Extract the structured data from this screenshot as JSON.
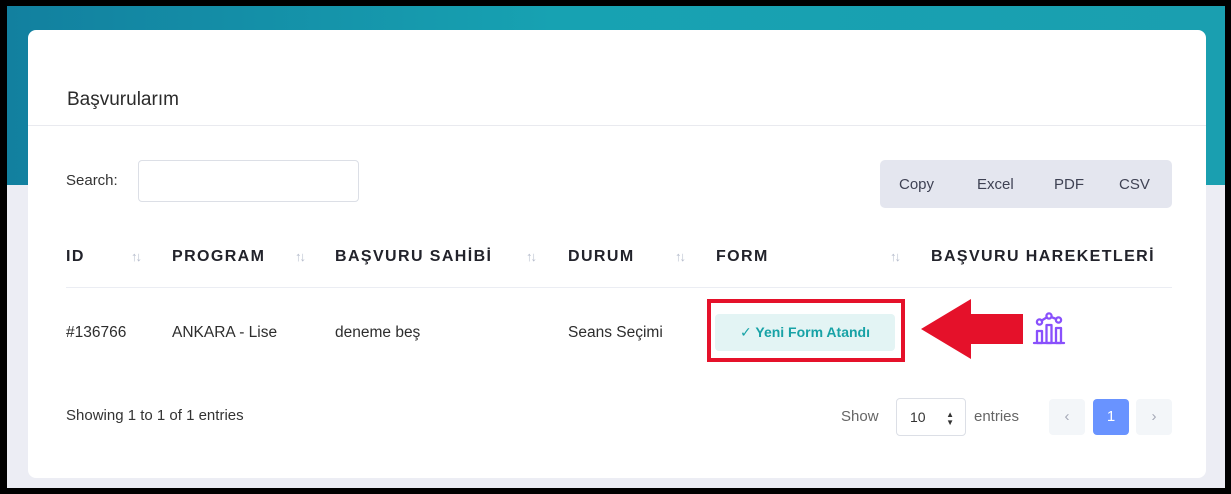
{
  "card": {
    "title": "Başvurularım"
  },
  "search": {
    "label": "Search:",
    "value": "",
    "placeholder": ""
  },
  "export_buttons": [
    "Copy",
    "Excel",
    "PDF",
    "CSV"
  ],
  "table": {
    "headers": [
      "ID",
      "PROGRAM",
      "BAŞVURU SAHİBİ",
      "DURUM",
      "FORM",
      "BAŞVURU HAREKETLERİ"
    ],
    "sort_icon": "↑↓",
    "rows": [
      {
        "id": "#136766",
        "program": "ANKARA - Lise",
        "owner": "deneme beş",
        "status": "Seans Seçimi",
        "form_check": "✓",
        "form_label": "Yeni Form Atandı",
        "history_icon": "chart-history-icon"
      }
    ]
  },
  "footer": {
    "info": "Showing 1 to 1 of 1 entries",
    "show_label": "Show",
    "page_length": "10",
    "entries_label": "entries",
    "pages": {
      "prev": "‹",
      "current": "1",
      "next": "›"
    }
  },
  "colors": {
    "primary": "#6993ff",
    "highlight_red": "#e5112a",
    "status_teal": "#17a2a6",
    "history_purple": "#8950fc"
  }
}
